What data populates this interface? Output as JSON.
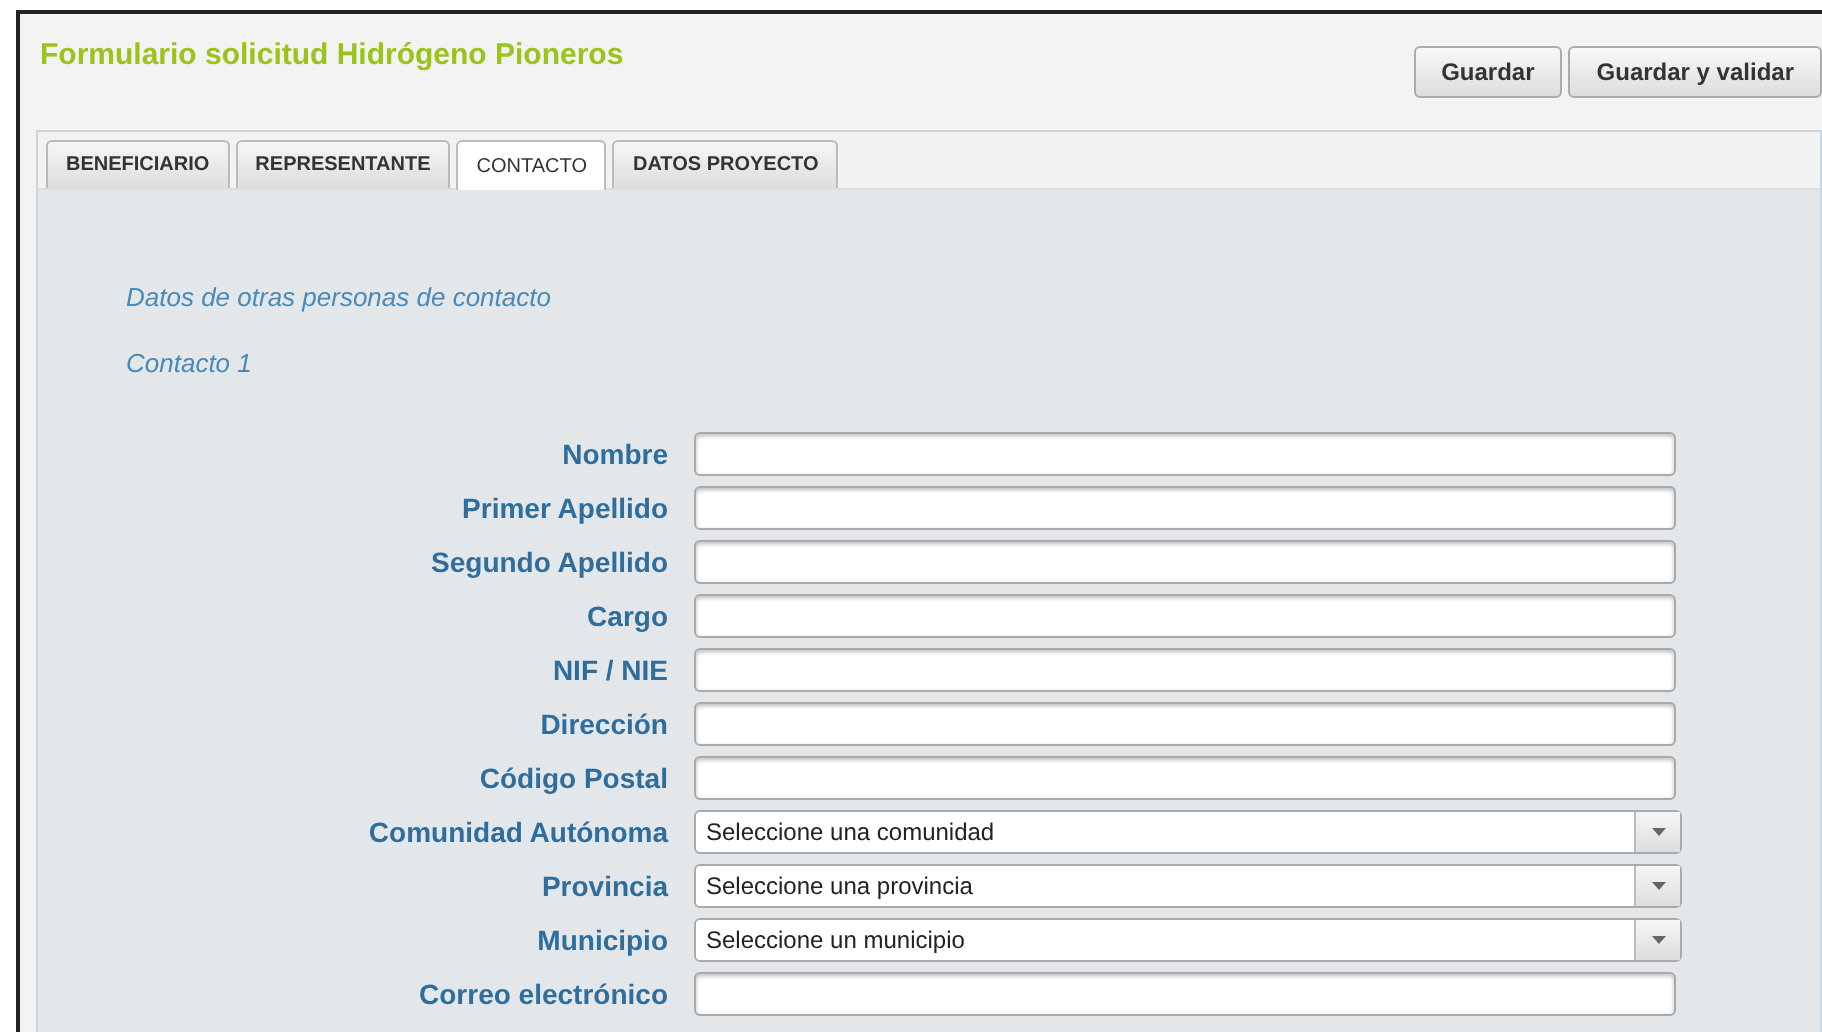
{
  "title": "Formulario solicitud Hidrógeno Pioneros",
  "buttons": [
    "Guardar",
    "Guardar y validar"
  ],
  "tabs": [
    {
      "label": "BENEFICIARIO",
      "selected": false
    },
    {
      "label": "REPRESENTANTE",
      "selected": false
    },
    {
      "label": "CONTACTO",
      "selected": true
    },
    {
      "label": "DATOS PROYECTO",
      "selected": false
    }
  ],
  "section_title": "Datos de otras personas de contacto",
  "subsection_title": "Contacto 1",
  "fields": [
    {
      "label": "Nombre",
      "kind": "text"
    },
    {
      "label": "Primer Apellido",
      "kind": "text"
    },
    {
      "label": "Segundo Apellido",
      "kind": "text"
    },
    {
      "label": "Cargo",
      "kind": "text"
    },
    {
      "label": "NIF / NIE",
      "kind": "text"
    },
    {
      "label": "Dirección",
      "kind": "text"
    },
    {
      "label": "Código Postal",
      "kind": "text"
    },
    {
      "label": "Comunidad Autónoma",
      "kind": "select",
      "value": "Seleccione una comunidad"
    },
    {
      "label": "Provincia",
      "kind": "select",
      "value": "Seleccione una provincia"
    },
    {
      "label": "Municipio",
      "kind": "select",
      "value": "Seleccione un municipio"
    },
    {
      "label": "Correo electrónico",
      "kind": "text"
    }
  ]
}
